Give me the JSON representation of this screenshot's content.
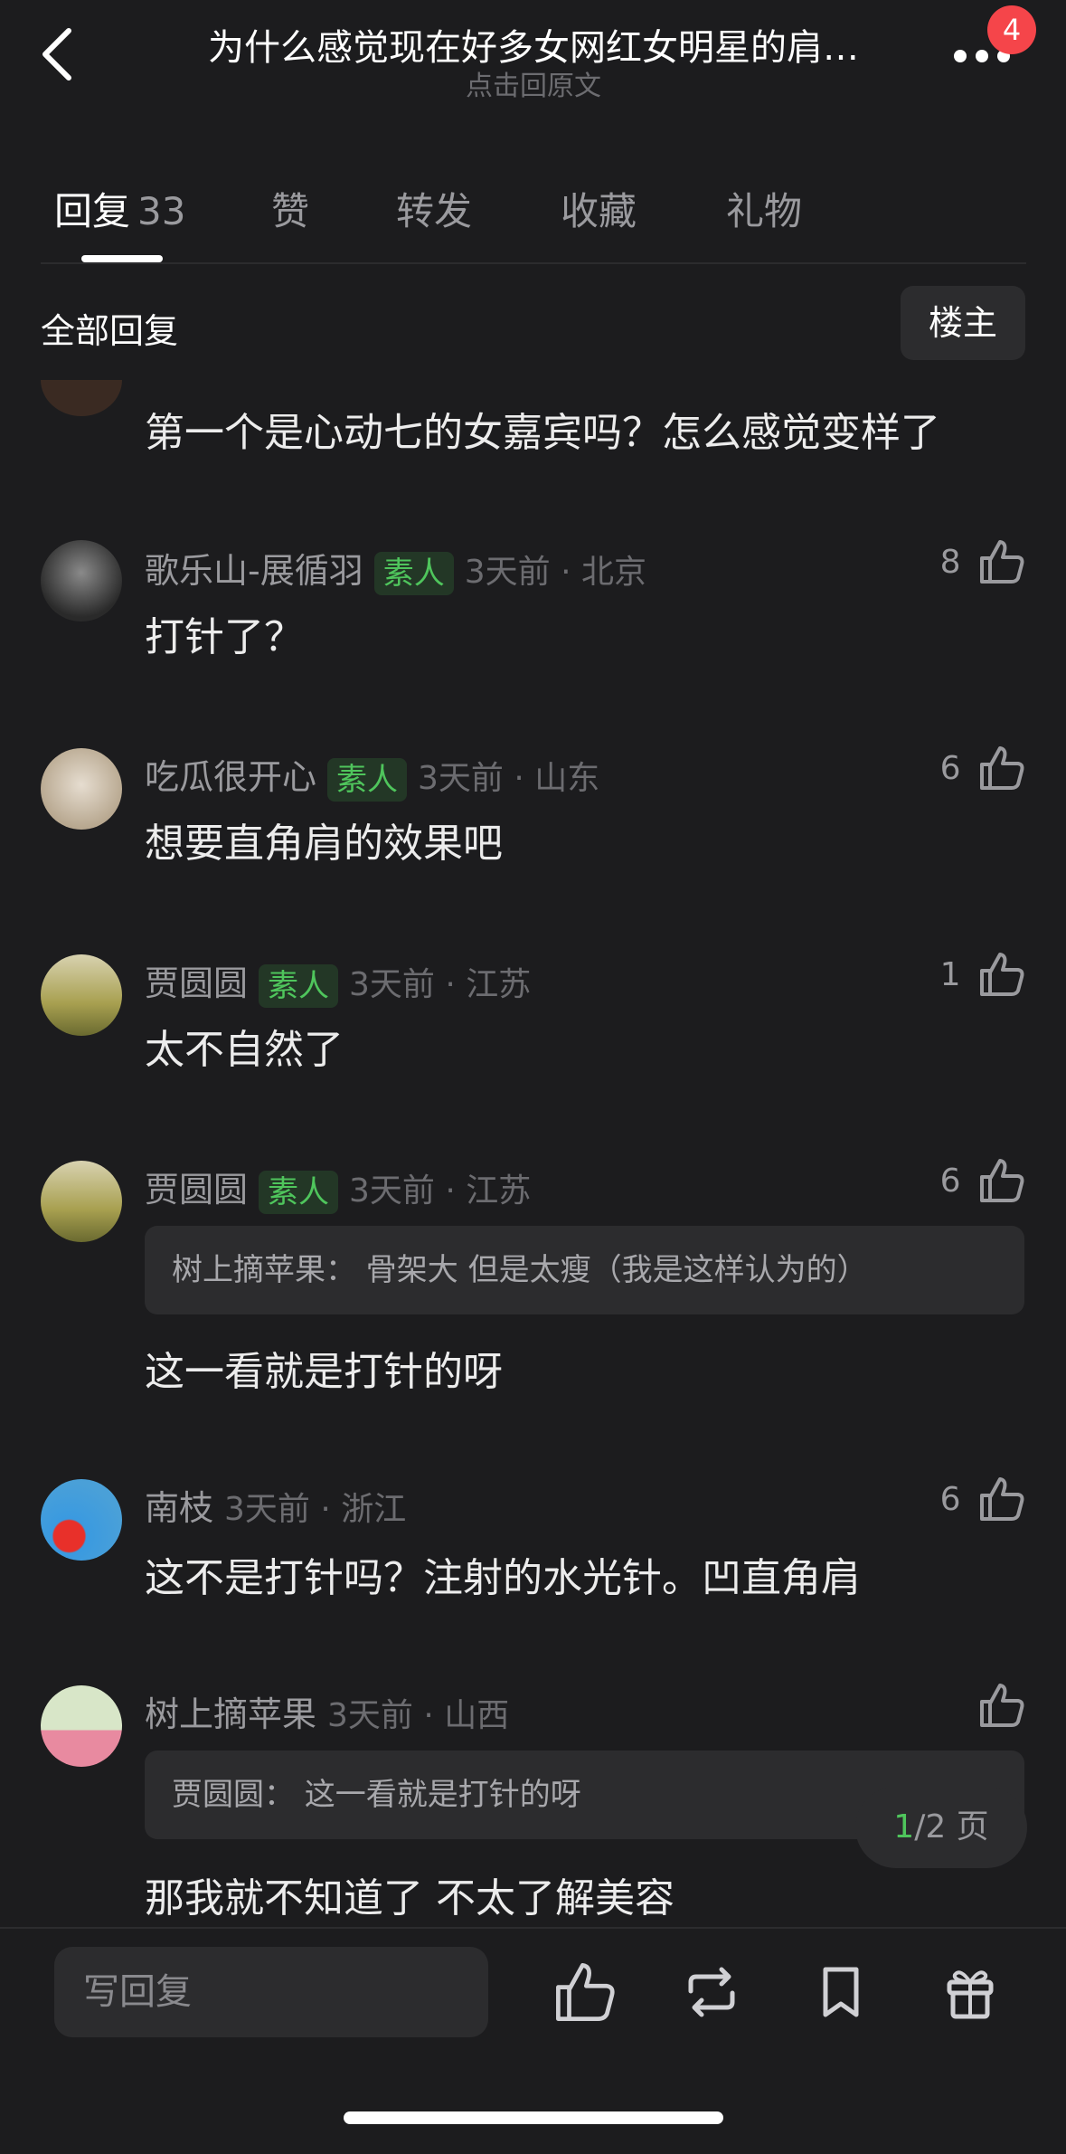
{
  "header": {
    "title": "为什么感觉现在好多女网红女明星的肩…",
    "subtitle": "点击回原文",
    "badge": "4"
  },
  "tabs": [
    {
      "label": "回复",
      "count": "33"
    },
    {
      "label": "赞"
    },
    {
      "label": "转发"
    },
    {
      "label": "收藏"
    },
    {
      "label": "礼物"
    }
  ],
  "section": {
    "title": "全部回复",
    "owner_button": "楼主"
  },
  "comments": [
    {
      "text": "第一个是心动七的女嘉宾吗？怎么感觉变样了"
    },
    {
      "name": "歌乐山-展循羽",
      "tag": "素人",
      "meta": "3天前 · 北京",
      "likes": "8",
      "text": "打针了？"
    },
    {
      "name": "吃瓜很开心",
      "tag": "素人",
      "meta": "3天前 · 山东",
      "likes": "6",
      "text": "想要直角肩的效果吧"
    },
    {
      "name": "贾圆圆",
      "tag": "素人",
      "meta": "3天前 · 江苏",
      "likes": "1",
      "text": "太不自然了"
    },
    {
      "name": "贾圆圆",
      "tag": "素人",
      "meta": "3天前 · 江苏",
      "likes": "6",
      "quote": "树上摘苹果： 骨架大 但是太瘦（我是这样认为的）",
      "text": "这一看就是打针的呀"
    },
    {
      "name": "南枝",
      "meta": "3天前 · 浙江",
      "likes": "6",
      "text": "这不是打针吗？注射的水光针。凹直角肩"
    },
    {
      "name": "树上摘苹果",
      "meta": "3天前 · 山西",
      "likes": "",
      "quote": "贾圆圆： 这一看就是打针的呀",
      "text": "那我就不知道了 不太了解美容"
    }
  ],
  "pager": {
    "current": "1",
    "total": "/2 页"
  },
  "bottom_bar": {
    "reply_placeholder": "写回复"
  },
  "colors": {
    "background": "#1c1c1e",
    "accent_green": "#4fc55c",
    "badge_red": "#f5454a"
  }
}
